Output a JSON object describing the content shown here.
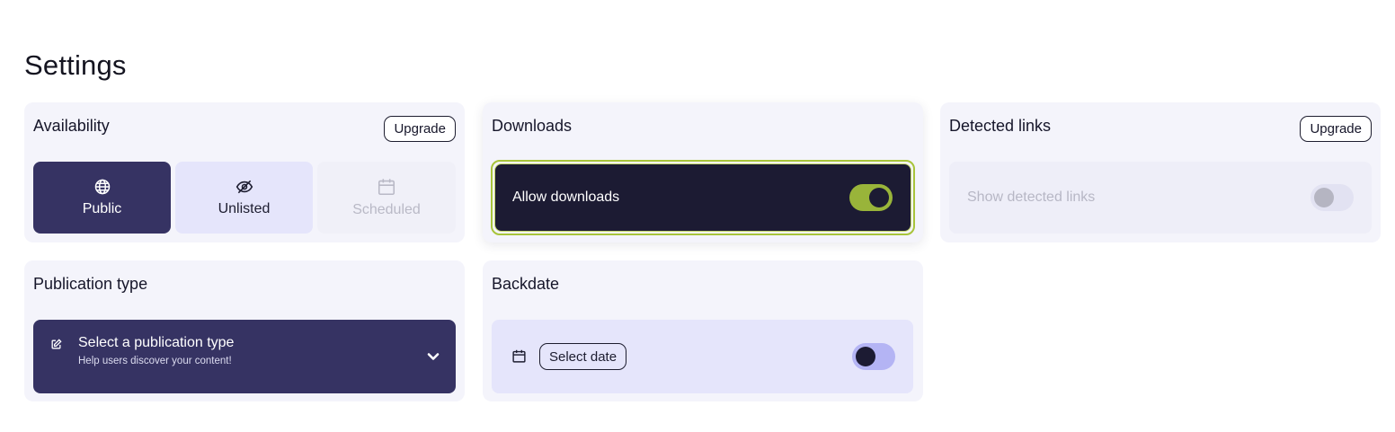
{
  "page": {
    "title": "Settings"
  },
  "availability": {
    "title": "Availability",
    "upgrade_label": "Upgrade",
    "options": [
      {
        "label": "Public",
        "icon": "globe-icon",
        "state": "selected"
      },
      {
        "label": "Unlisted",
        "icon": "eye-off-icon",
        "state": "default"
      },
      {
        "label": "Scheduled",
        "icon": "calendar-icon",
        "state": "disabled"
      }
    ]
  },
  "downloads": {
    "title": "Downloads",
    "toggle_label": "Allow downloads",
    "enabled": true
  },
  "detected_links": {
    "title": "Detected links",
    "upgrade_label": "Upgrade",
    "toggle_label": "Show detected links",
    "enabled": false,
    "disabled": true
  },
  "publication_type": {
    "title": "Publication type",
    "select_label": "Select a publication type",
    "select_hint": "Help users discover your content!"
  },
  "backdate": {
    "title": "Backdate",
    "select_date_label": "Select date",
    "enabled": false
  },
  "colors": {
    "primary": "#363363",
    "accent": "#99b43a",
    "card_bg": "#f4f4fb",
    "dark": "#1c1b33"
  }
}
